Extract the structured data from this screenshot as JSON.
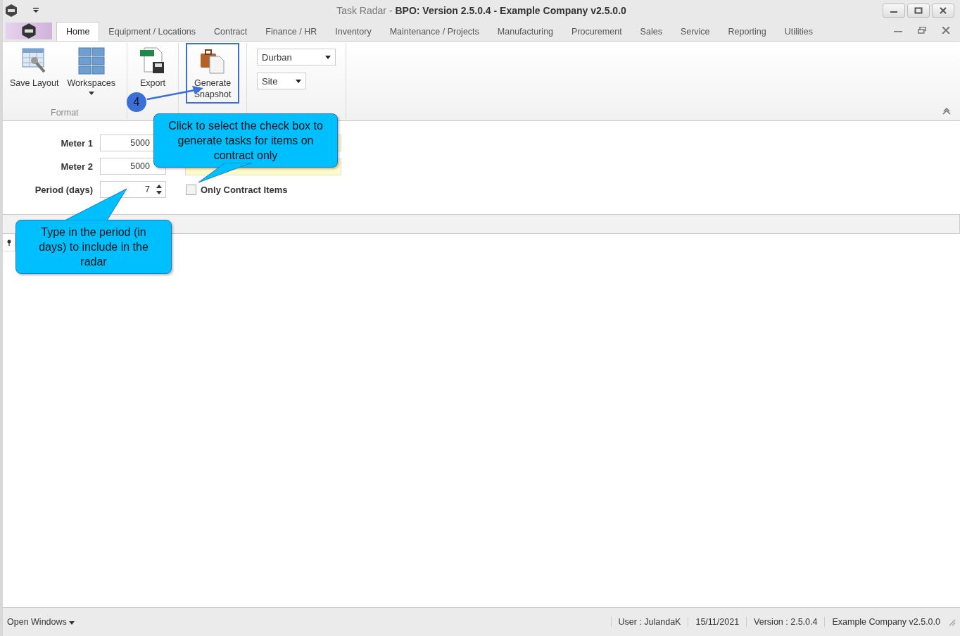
{
  "window": {
    "title": "Task Radar - **BPO: Version 2.5.0.4 - Example Company v2.5.0.0**"
  },
  "tabs": [
    {
      "label": "Home",
      "selected": true
    },
    {
      "label": "Equipment / Locations",
      "selected": false
    },
    {
      "label": "Contract",
      "selected": false
    },
    {
      "label": "Finance / HR",
      "selected": false
    },
    {
      "label": "Inventory",
      "selected": false
    },
    {
      "label": "Maintenance / Projects",
      "selected": false
    },
    {
      "label": "Manufacturing",
      "selected": false
    },
    {
      "label": "Procurement",
      "selected": false
    },
    {
      "label": "Sales",
      "selected": false
    },
    {
      "label": "Service",
      "selected": false
    },
    {
      "label": "Reporting",
      "selected": false
    },
    {
      "label": "Utilities",
      "selected": false
    }
  ],
  "ribbon": {
    "buttons": [
      {
        "kind": "layout",
        "label": "Save Layout",
        "dropdown": false,
        "highlighted": false
      },
      {
        "kind": "workspaces",
        "label": "Workspaces",
        "dropdown": true,
        "highlighted": false
      },
      {
        "kind": "export",
        "label": "Export",
        "dropdown": false,
        "highlighted": false
      },
      {
        "kind": "snapshot",
        "label": "Generate Snapshot",
        "dropdown": false,
        "highlighted": true
      }
    ],
    "group_label": "Format",
    "location": "Durban",
    "scope": "Site"
  },
  "step_badge": "4",
  "form": {
    "meters": [
      {
        "label": "Meter 1",
        "value": "5000"
      },
      {
        "label": "Meter 2",
        "value": "5000"
      }
    ],
    "period": {
      "label": "Period (days)",
      "value": "7"
    },
    "contract_only": {
      "label": "Only Contract Items",
      "checked": false
    }
  },
  "callouts": [
    "Click to select the check box to generate tasks for items on contract only",
    "Type in the period (in days) to include in the radar"
  ],
  "status_bar": {
    "menu": "Open Windows",
    "items": [
      "User : JulandaK",
      "15/11/2021",
      "Version : 2.5.0.4",
      "Example Company v2.5.0.0"
    ]
  }
}
